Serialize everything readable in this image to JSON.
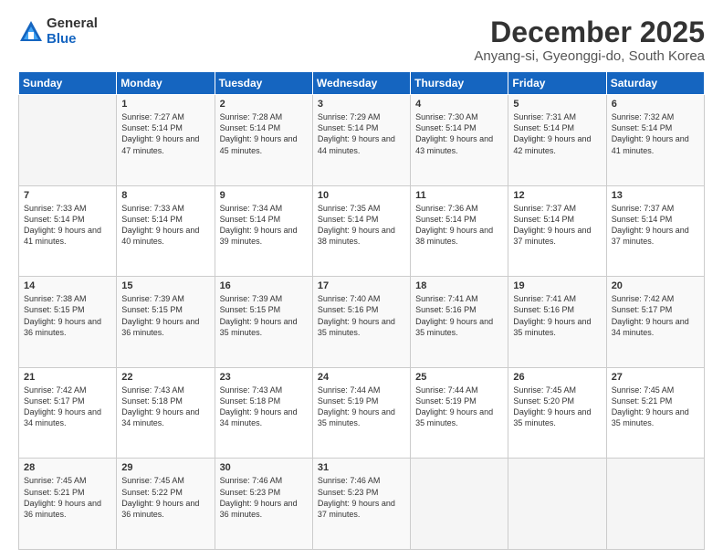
{
  "logo": {
    "general": "General",
    "blue": "Blue"
  },
  "title": "December 2025",
  "subtitle": "Anyang-si, Gyeonggi-do, South Korea",
  "days_header": [
    "Sunday",
    "Monday",
    "Tuesday",
    "Wednesday",
    "Thursday",
    "Friday",
    "Saturday"
  ],
  "weeks": [
    [
      {
        "day": "",
        "sunrise": "",
        "sunset": "",
        "daylight": ""
      },
      {
        "day": "1",
        "sunrise": "Sunrise: 7:27 AM",
        "sunset": "Sunset: 5:14 PM",
        "daylight": "Daylight: 9 hours and 47 minutes."
      },
      {
        "day": "2",
        "sunrise": "Sunrise: 7:28 AM",
        "sunset": "Sunset: 5:14 PM",
        "daylight": "Daylight: 9 hours and 45 minutes."
      },
      {
        "day": "3",
        "sunrise": "Sunrise: 7:29 AM",
        "sunset": "Sunset: 5:14 PM",
        "daylight": "Daylight: 9 hours and 44 minutes."
      },
      {
        "day": "4",
        "sunrise": "Sunrise: 7:30 AM",
        "sunset": "Sunset: 5:14 PM",
        "daylight": "Daylight: 9 hours and 43 minutes."
      },
      {
        "day": "5",
        "sunrise": "Sunrise: 7:31 AM",
        "sunset": "Sunset: 5:14 PM",
        "daylight": "Daylight: 9 hours and 42 minutes."
      },
      {
        "day": "6",
        "sunrise": "Sunrise: 7:32 AM",
        "sunset": "Sunset: 5:14 PM",
        "daylight": "Daylight: 9 hours and 41 minutes."
      }
    ],
    [
      {
        "day": "7",
        "sunrise": "Sunrise: 7:33 AM",
        "sunset": "Sunset: 5:14 PM",
        "daylight": "Daylight: 9 hours and 41 minutes."
      },
      {
        "day": "8",
        "sunrise": "Sunrise: 7:33 AM",
        "sunset": "Sunset: 5:14 PM",
        "daylight": "Daylight: 9 hours and 40 minutes."
      },
      {
        "day": "9",
        "sunrise": "Sunrise: 7:34 AM",
        "sunset": "Sunset: 5:14 PM",
        "daylight": "Daylight: 9 hours and 39 minutes."
      },
      {
        "day": "10",
        "sunrise": "Sunrise: 7:35 AM",
        "sunset": "Sunset: 5:14 PM",
        "daylight": "Daylight: 9 hours and 38 minutes."
      },
      {
        "day": "11",
        "sunrise": "Sunrise: 7:36 AM",
        "sunset": "Sunset: 5:14 PM",
        "daylight": "Daylight: 9 hours and 38 minutes."
      },
      {
        "day": "12",
        "sunrise": "Sunrise: 7:37 AM",
        "sunset": "Sunset: 5:14 PM",
        "daylight": "Daylight: 9 hours and 37 minutes."
      },
      {
        "day": "13",
        "sunrise": "Sunrise: 7:37 AM",
        "sunset": "Sunset: 5:14 PM",
        "daylight": "Daylight: 9 hours and 37 minutes."
      }
    ],
    [
      {
        "day": "14",
        "sunrise": "Sunrise: 7:38 AM",
        "sunset": "Sunset: 5:15 PM",
        "daylight": "Daylight: 9 hours and 36 minutes."
      },
      {
        "day": "15",
        "sunrise": "Sunrise: 7:39 AM",
        "sunset": "Sunset: 5:15 PM",
        "daylight": "Daylight: 9 hours and 36 minutes."
      },
      {
        "day": "16",
        "sunrise": "Sunrise: 7:39 AM",
        "sunset": "Sunset: 5:15 PM",
        "daylight": "Daylight: 9 hours and 35 minutes."
      },
      {
        "day": "17",
        "sunrise": "Sunrise: 7:40 AM",
        "sunset": "Sunset: 5:16 PM",
        "daylight": "Daylight: 9 hours and 35 minutes."
      },
      {
        "day": "18",
        "sunrise": "Sunrise: 7:41 AM",
        "sunset": "Sunset: 5:16 PM",
        "daylight": "Daylight: 9 hours and 35 minutes."
      },
      {
        "day": "19",
        "sunrise": "Sunrise: 7:41 AM",
        "sunset": "Sunset: 5:16 PM",
        "daylight": "Daylight: 9 hours and 35 minutes."
      },
      {
        "day": "20",
        "sunrise": "Sunrise: 7:42 AM",
        "sunset": "Sunset: 5:17 PM",
        "daylight": "Daylight: 9 hours and 34 minutes."
      }
    ],
    [
      {
        "day": "21",
        "sunrise": "Sunrise: 7:42 AM",
        "sunset": "Sunset: 5:17 PM",
        "daylight": "Daylight: 9 hours and 34 minutes."
      },
      {
        "day": "22",
        "sunrise": "Sunrise: 7:43 AM",
        "sunset": "Sunset: 5:18 PM",
        "daylight": "Daylight: 9 hours and 34 minutes."
      },
      {
        "day": "23",
        "sunrise": "Sunrise: 7:43 AM",
        "sunset": "Sunset: 5:18 PM",
        "daylight": "Daylight: 9 hours and 34 minutes."
      },
      {
        "day": "24",
        "sunrise": "Sunrise: 7:44 AM",
        "sunset": "Sunset: 5:19 PM",
        "daylight": "Daylight: 9 hours and 35 minutes."
      },
      {
        "day": "25",
        "sunrise": "Sunrise: 7:44 AM",
        "sunset": "Sunset: 5:19 PM",
        "daylight": "Daylight: 9 hours and 35 minutes."
      },
      {
        "day": "26",
        "sunrise": "Sunrise: 7:45 AM",
        "sunset": "Sunset: 5:20 PM",
        "daylight": "Daylight: 9 hours and 35 minutes."
      },
      {
        "day": "27",
        "sunrise": "Sunrise: 7:45 AM",
        "sunset": "Sunset: 5:21 PM",
        "daylight": "Daylight: 9 hours and 35 minutes."
      }
    ],
    [
      {
        "day": "28",
        "sunrise": "Sunrise: 7:45 AM",
        "sunset": "Sunset: 5:21 PM",
        "daylight": "Daylight: 9 hours and 36 minutes."
      },
      {
        "day": "29",
        "sunrise": "Sunrise: 7:45 AM",
        "sunset": "Sunset: 5:22 PM",
        "daylight": "Daylight: 9 hours and 36 minutes."
      },
      {
        "day": "30",
        "sunrise": "Sunrise: 7:46 AM",
        "sunset": "Sunset: 5:23 PM",
        "daylight": "Daylight: 9 hours and 36 minutes."
      },
      {
        "day": "31",
        "sunrise": "Sunrise: 7:46 AM",
        "sunset": "Sunset: 5:23 PM",
        "daylight": "Daylight: 9 hours and 37 minutes."
      },
      {
        "day": "",
        "sunrise": "",
        "sunset": "",
        "daylight": ""
      },
      {
        "day": "",
        "sunrise": "",
        "sunset": "",
        "daylight": ""
      },
      {
        "day": "",
        "sunrise": "",
        "sunset": "",
        "daylight": ""
      }
    ]
  ]
}
